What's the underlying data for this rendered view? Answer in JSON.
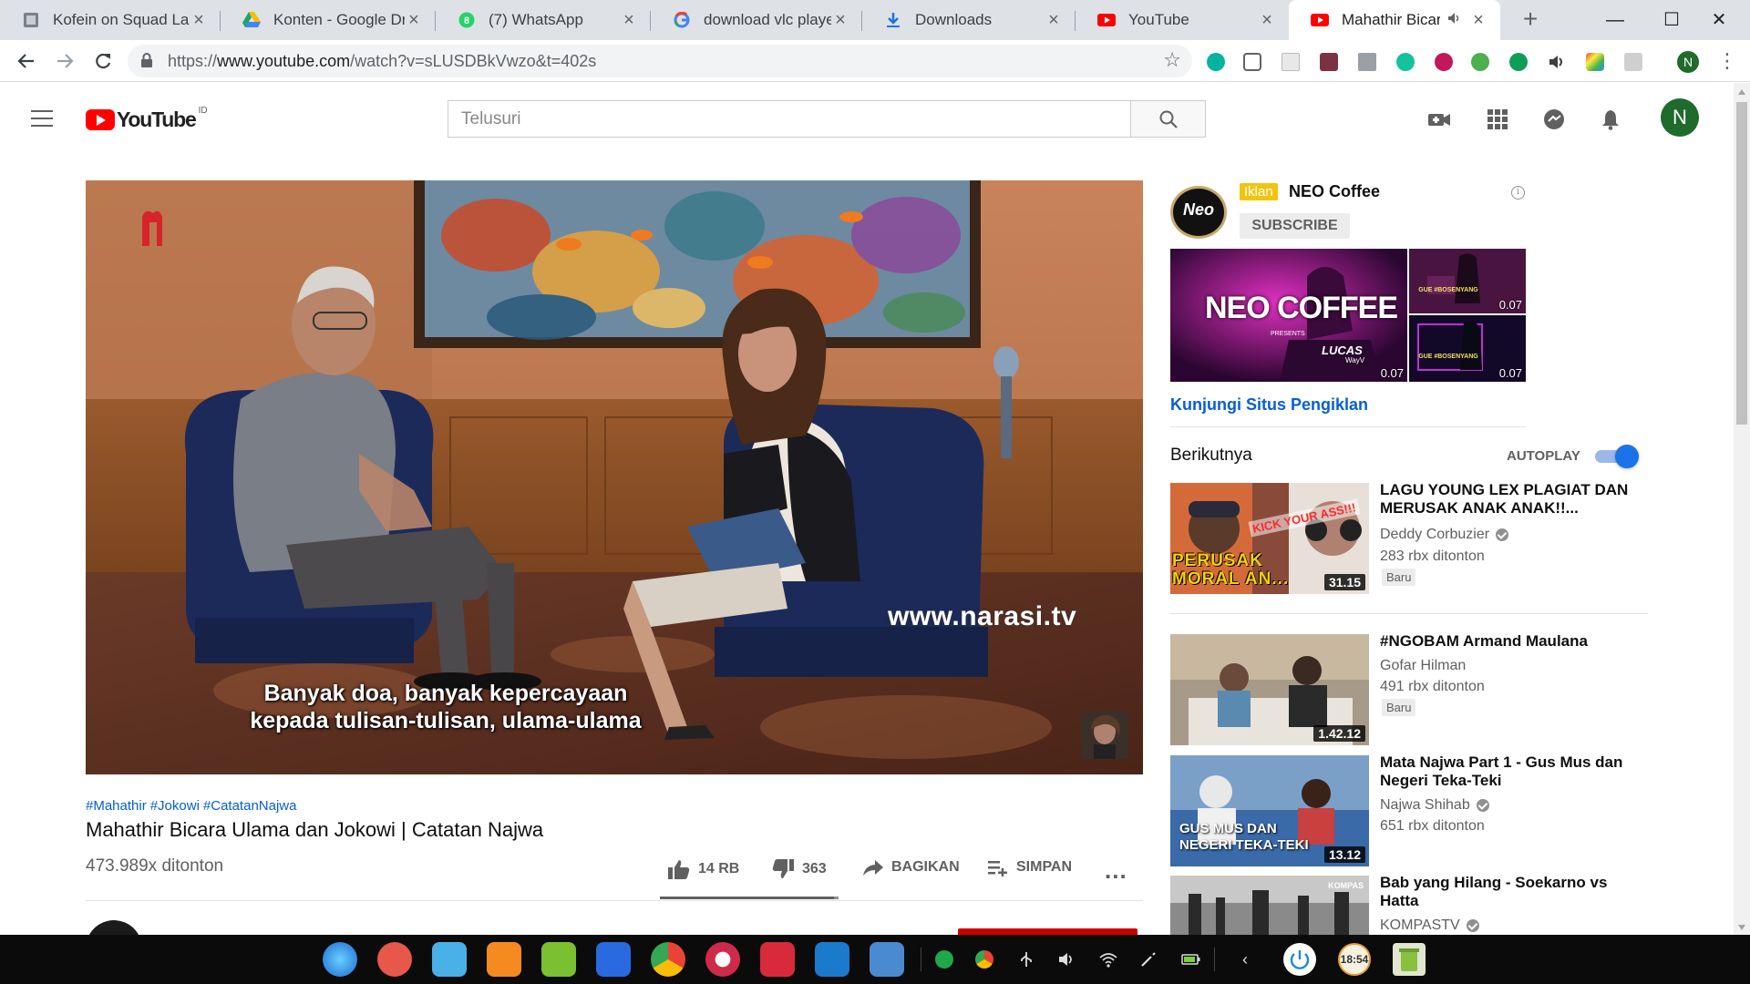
{
  "browser": {
    "tabs": [
      {
        "title": "Kofein on Squad Lan",
        "icon": "squad-favicon-icon"
      },
      {
        "title": "Konten - Google Driv",
        "icon": "google-drive-icon"
      },
      {
        "title": "(7) WhatsApp",
        "icon": "whatsapp-icon"
      },
      {
        "title": "download vlc player",
        "icon": "google-icon"
      },
      {
        "title": "Downloads",
        "icon": "download-icon"
      },
      {
        "title": "YouTube",
        "icon": "youtube-icon"
      },
      {
        "title": "Mahathir Bicara",
        "icon": "youtube-icon",
        "active": true
      }
    ],
    "url_prefix": "https://",
    "url_host": "www.youtube.com",
    "url_path": "/watch?v=sLUSDBkVwzo&t=402s",
    "profile_initial": "N"
  },
  "youtube": {
    "logo_text": "YouTube",
    "country_code": "ID",
    "search_placeholder": "Telusuri",
    "avatar_initial": "N"
  },
  "video": {
    "subtitle_line1": "Banyak doa, banyak kepercayaan",
    "subtitle_line2": "kepada tulisan-tulisan, ulama-ulama",
    "watermark": "www.narasi.tv",
    "hashtags": [
      "#Mahathir",
      "#Jokowi",
      "#CatatanNajwa"
    ],
    "title": "Mahathir Bicara Ulama dan Jokowi | Catatan Najwa",
    "views": "473.989x ditonton",
    "likes": "14 RB",
    "dislikes": "363",
    "like_ratio": 0.975,
    "share_label": "BAGIKAN",
    "save_label": "SIMPAN",
    "more_label": "..."
  },
  "ad": {
    "badge": "Iklan",
    "advertiser": "NEO Coffee",
    "logo_text": "Neo",
    "subscribe_label": "SUBSCRIBE",
    "info_glyph": "i",
    "main_thumb_title": "NEO COFFEE",
    "main_thumb_presents": "PRESENTS",
    "main_thumb_name": "LUCAS",
    "main_thumb_sub": "WayV",
    "thumb_tag": "GUE #BOSENYANG",
    "durations": [
      "0.07",
      "0.07",
      "0.07"
    ],
    "visit_label": "Kunjungi Situs Pengiklan"
  },
  "upnext": {
    "label": "Berikutnya",
    "autoplay_label": "AUTOPLAY",
    "autoplay_on": true,
    "items": [
      {
        "title": "LAGU YOUNG LEX PLAGIAT DAN MERUSAK ANAK ANAK!!...",
        "channel": "Deddy Corbuzier",
        "verified": true,
        "views": "283 rbx ditonton",
        "badge": "Baru",
        "duration": "31.15",
        "thumb_text": "PERUSAK MORAL AN...",
        "thumb_sticker": "KICK YOUR ASS!!!"
      },
      {
        "title": "#NGOBAM Armand Maulana",
        "channel": "Gofar Hilman",
        "verified": false,
        "views": "491 rbx ditonton",
        "badge": "Baru",
        "duration": "1.42.12"
      },
      {
        "title": "Mata Najwa Part 1 - Gus Mus dan Negeri Teka-Teki",
        "channel": "Najwa Shihab",
        "verified": true,
        "views": "651 rbx ditonton",
        "badge": "",
        "duration": "13.12",
        "thumb_text": "GUS MUS DAN NEGERI TEKA-TEKI"
      },
      {
        "title": "Bab yang Hilang - Soekarno vs Hatta",
        "channel": "KOMPASTV",
        "verified": true,
        "views": "",
        "badge": "",
        "duration": "",
        "thumb_tag": "KOMPAS"
      }
    ]
  },
  "dock": {
    "clock": "18:54",
    "apps": [
      "deepin-launcher-icon",
      "screen-recorder-icon",
      "file-manager-icon",
      "app-store-icon",
      "music-player-icon",
      "movie-player-icon",
      "chrome-icon",
      "settings-icon",
      "terminal-icon",
      "vscode-icon",
      "notes-icon"
    ],
    "colors": {
      "accent": "#1a73e8",
      "youtube_red": "#ff0000",
      "link_blue": "#065fd4"
    }
  }
}
